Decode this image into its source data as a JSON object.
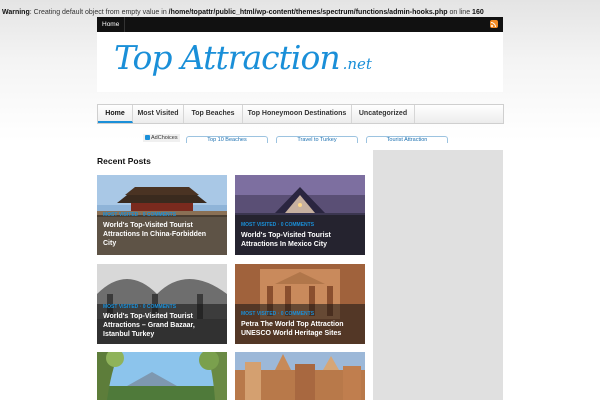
{
  "warning": {
    "label": "Warning",
    "message": ": Creating default object from empty value in ",
    "path": "/home/topattr/public_html/wp-content/themes/spectrum/functions/admin-hooks.php",
    "line_text": " on line ",
    "line": "160"
  },
  "topbar": {
    "home": "Home",
    "rss_icon": "rss-icon"
  },
  "logo": {
    "main": "Top Attraction",
    "suffix": ".net"
  },
  "nav": {
    "items": [
      "Home",
      "Most Visited",
      "Top Beaches",
      "Top Honeymoon Destinations",
      "Uncategorized"
    ]
  },
  "ads": {
    "adchoices": "AdChoices",
    "links": [
      "Top 10 Beaches",
      "Travel to Turkey",
      "Tourist Attraction"
    ]
  },
  "recent": {
    "title": "Recent Posts"
  },
  "posts": [
    {
      "meta": "MOST VISITED · 0 COMMENTS",
      "title": "World's Top-Visited Tourist Attractions In China-Forbidden City"
    },
    {
      "meta": "MOST VISITED · 0 COMMENTS",
      "title": "World's Top-Visited Tourist Attractions In Mexico City"
    },
    {
      "meta": "MOST VISITED · 0 COMMENTS",
      "title": "World's Top-Visited Tourist Attractions – Grand Bazaar, Istanbul Turkey"
    },
    {
      "meta": "MOST VISITED · 0 COMMENTS",
      "title": "Petra The World Top Attraction UNESCO World Heritage Sites"
    },
    {
      "meta": "",
      "title": ""
    },
    {
      "meta": "",
      "title": ""
    }
  ]
}
